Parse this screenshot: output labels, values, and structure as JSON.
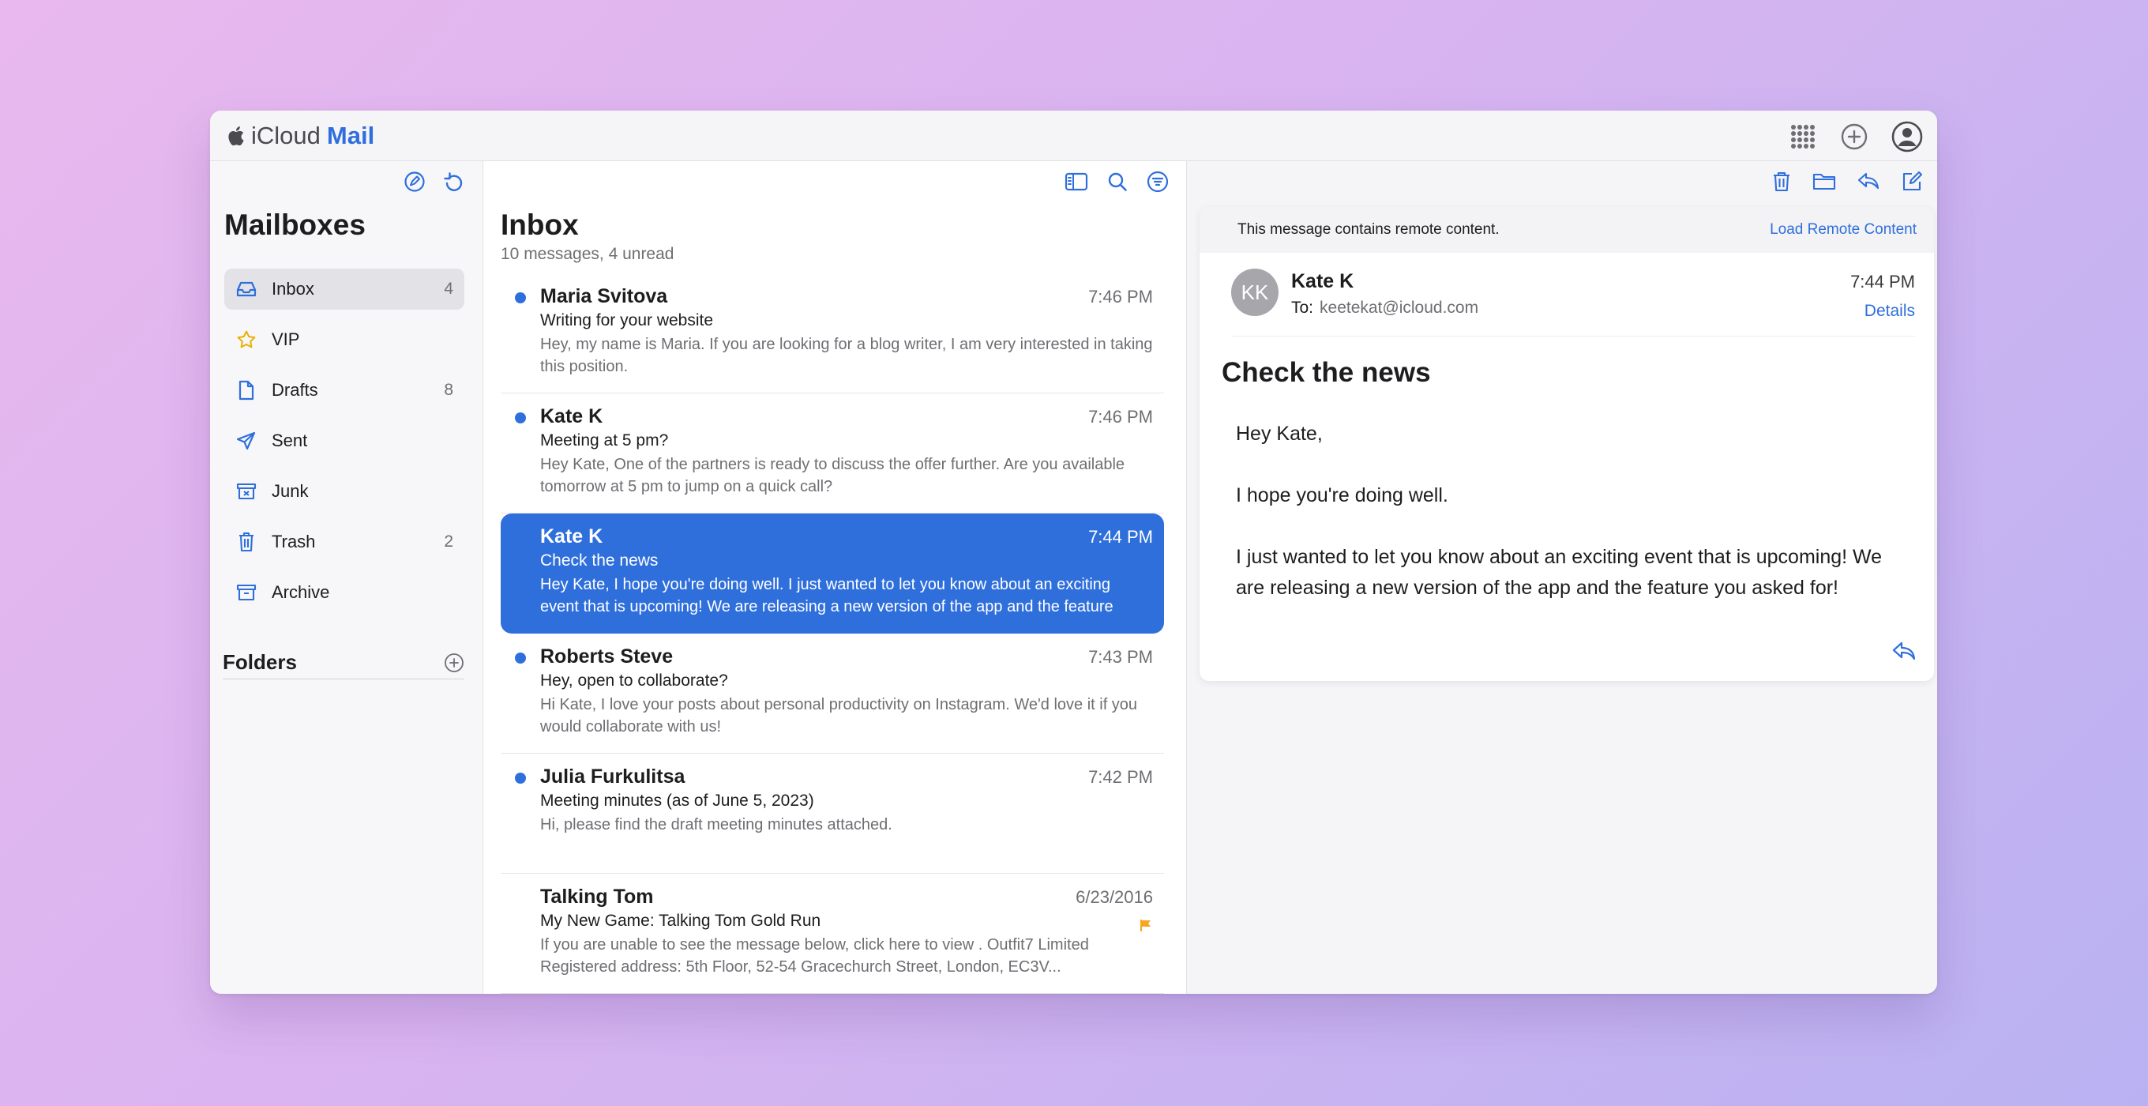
{
  "brand": {
    "icloud": "iCloud",
    "mail": "Mail"
  },
  "colors": {
    "accent": "#2f6fdc",
    "flag": "#f5a623"
  },
  "topbar_icons": [
    "app-grid-icon",
    "plus-circle-icon",
    "account-icon"
  ],
  "sidebar": {
    "title": "Mailboxes",
    "tools": [
      "compose-mailbox-icon",
      "refresh-icon"
    ],
    "items": [
      {
        "label": "Inbox",
        "count": "4",
        "icon": "inbox-icon",
        "selected": true
      },
      {
        "label": "VIP",
        "count": "",
        "icon": "star-icon"
      },
      {
        "label": "Drafts",
        "count": "8",
        "icon": "document-icon"
      },
      {
        "label": "Sent",
        "count": "",
        "icon": "paper-plane-icon"
      },
      {
        "label": "Junk",
        "count": "",
        "icon": "junk-box-icon"
      },
      {
        "label": "Trash",
        "count": "2",
        "icon": "trash-icon"
      },
      {
        "label": "Archive",
        "count": "",
        "icon": "archive-box-icon"
      }
    ],
    "folders_title": "Folders"
  },
  "list": {
    "title": "Inbox",
    "subtitle": "10 messages, 4 unread",
    "tools": [
      "sidebar-toggle-icon",
      "search-icon",
      "filter-icon"
    ],
    "messages": [
      {
        "sender": "Maria Svitova",
        "time": "7:46 PM",
        "subject": "Writing for your website",
        "preview": "Hey, my name is Maria. If you are looking for a blog writer, I am very interested in taking this position.",
        "unread": true
      },
      {
        "sender": "Kate K",
        "time": "7:46 PM",
        "subject": "Meeting at 5 pm?",
        "preview": "Hey Kate, One of the partners is ready to discuss the offer further. Are you available tomorrow at 5 pm to jump on a quick call?",
        "unread": true
      },
      {
        "sender": "Kate K",
        "time": "7:44 PM",
        "subject": "Check the news",
        "preview": "Hey Kate, I hope you're doing well. I just wanted to let you know about an exciting event that is upcoming! We are releasing a new version of the app and the feature",
        "unread": false,
        "selected": true
      },
      {
        "sender": "Roberts Steve",
        "time": "7:43 PM",
        "subject": "Hey, open to collaborate?",
        "preview": "Hi Kate, I love your posts about personal productivity on Instagram. We'd love it if you would collaborate with us!",
        "unread": true
      },
      {
        "sender": "Julia Furkulitsa",
        "time": "7:42 PM",
        "subject": "Meeting minutes (as of June 5, 2023)",
        "preview": "Hi, please find the draft meeting minutes attached.",
        "unread": true
      },
      {
        "sender": "Talking Tom",
        "time": "6/23/2016",
        "subject": "My New Game: Talking Tom Gold Run",
        "preview": "If you are unable to see the message below, click here to view . Outfit7 Limited Registered address: 5th Floor, 52-54 Gracechurch Street, London, EC3V...",
        "unread": false,
        "flagged": true
      }
    ]
  },
  "reader": {
    "tools": [
      "trash-icon",
      "folder-icon",
      "reply-icon",
      "compose-icon"
    ],
    "remote_notice": "This message contains remote content.",
    "remote_action": "Load Remote Content",
    "avatar": "KK",
    "sender": "Kate K",
    "to_label": "To:",
    "to_address": "keetekat@icloud.com",
    "time": "7:44 PM",
    "details": "Details",
    "subject": "Check the news",
    "body": [
      "Hey Kate,",
      "I hope you're doing well.",
      "I just wanted to let you know about an exciting event that is upcoming! We are releasing a new version of the app and the feature you asked for!"
    ]
  }
}
